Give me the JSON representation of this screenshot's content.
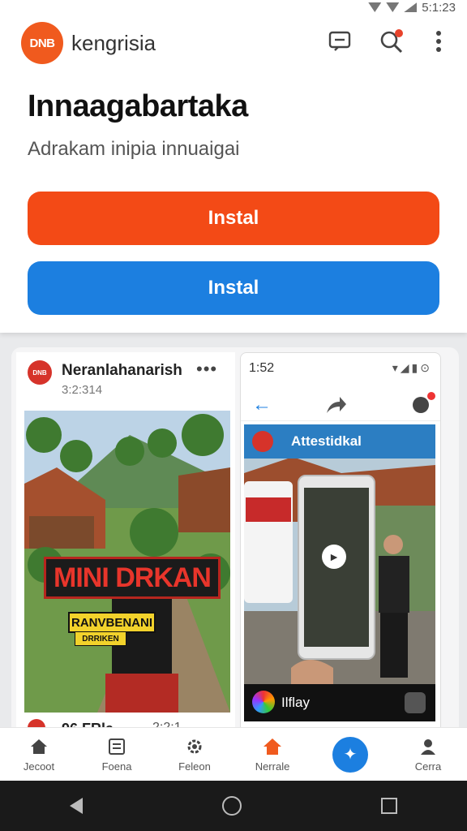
{
  "status_bar": {
    "time": "5:1:23"
  },
  "header": {
    "logo_text": "DNB",
    "brand": "kengrisia"
  },
  "hero": {
    "headline": "Innaagabartaka",
    "subline": "Adrakam inipia innuaigai",
    "install_primary": "Instal",
    "install_secondary": "Instal"
  },
  "post1": {
    "author": "Neranlahanarish",
    "time": "3:2:314",
    "more": "•••",
    "banner_main": "MINI DRKAN",
    "banner_sub1": "RANVBENANI",
    "banner_sub2": "DRRIKEN",
    "footer_label": "96 FRla",
    "footer_time": "2:2:1"
  },
  "post2": {
    "time": "1:52",
    "title": "Attestidkal",
    "footer_label": "Ilflay"
  },
  "bottom_nav": [
    {
      "label": "Jecoot",
      "icon": "home-icon"
    },
    {
      "label": "Foena",
      "icon": "news-icon"
    },
    {
      "label": "Feleon",
      "icon": "gear-icon"
    },
    {
      "label": "Nerrale",
      "icon": "home-icon"
    },
    {
      "label": "",
      "icon": "plus-fab-icon"
    },
    {
      "label": "Cerra",
      "icon": "person-icon"
    }
  ],
  "colors": {
    "orange": "#f34a16",
    "blue": "#1c7fe0",
    "logo": "#f05a1e"
  }
}
